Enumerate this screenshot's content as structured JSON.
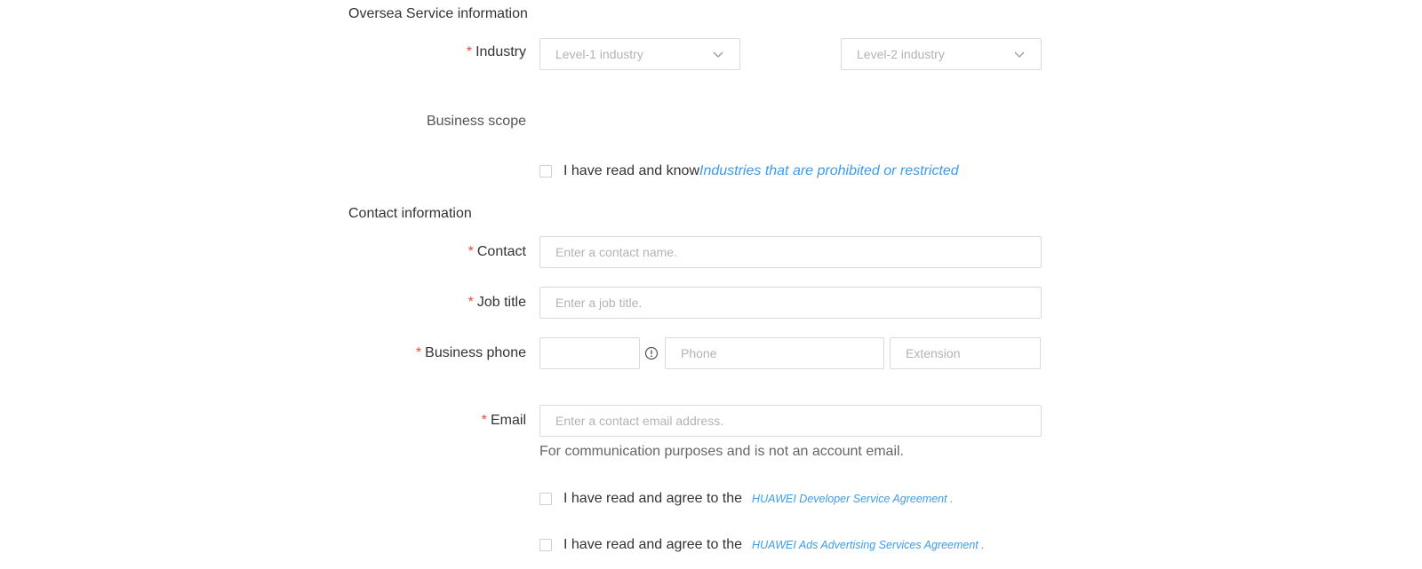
{
  "oversea_section": {
    "title": "Oversea Service information",
    "industry": {
      "required_mark": "*",
      "label": "Industry",
      "level1_placeholder": "Level-1 industry",
      "level2_placeholder": "Level-2 industry"
    },
    "business_scope": {
      "label": "Business scope"
    },
    "restriction_agreement": {
      "text": "I have read and know",
      "link": "Industries that are prohibited or restricted",
      "checked": false
    }
  },
  "contact_section": {
    "title": "Contact information",
    "contact": {
      "required_mark": "*",
      "label": "Contact",
      "placeholder": "Enter a contact name."
    },
    "job_title": {
      "required_mark": "*",
      "label": "Job title",
      "placeholder": "Enter a job title."
    },
    "business_phone": {
      "required_mark": "*",
      "label": "Business phone",
      "country_code_value": "",
      "phone_placeholder": "Phone",
      "extension_placeholder": "Extension"
    },
    "email": {
      "required_mark": "*",
      "label": "Email",
      "placeholder": "Enter a contact email address.",
      "hint": "For communication purposes and is not an account email."
    }
  },
  "agreements": [
    {
      "text": "I have read and agree to the",
      "link": "HUAWEI Developer Service Agreement .",
      "checked": false
    },
    {
      "text": "I have read and agree to the",
      "link": "HUAWEI Ads Advertising Services Agreement .",
      "checked": false
    }
  ],
  "icons": {
    "select_arrow": "chevron-down-icon",
    "phone_info": "info-icon"
  },
  "colors": {
    "required": "#f0483e",
    "link": "#3d9be9",
    "border": "#d9d9d9",
    "placeholder": "#b3b3b3"
  }
}
